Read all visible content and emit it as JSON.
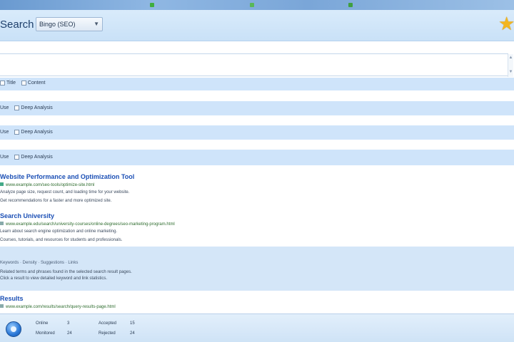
{
  "window": {
    "caption": ""
  },
  "header": {
    "title": "Search",
    "engine": "Bingo (SEO)",
    "star_label": "★"
  },
  "search": {
    "value": ""
  },
  "options": {
    "row1": [
      "Title",
      "Content"
    ],
    "row2": [
      "Use",
      "Deep Analysis"
    ],
    "row3": [
      "Use",
      "Deep Analysis"
    ],
    "row4": [
      "Use",
      "Deep Analysis"
    ]
  },
  "results": [
    {
      "title": "Website Performance and Optimization Tool",
      "url": "www.example.com/seo-tools/optimize-site.html",
      "snippet": [
        "Analyze page size, request count, and loading time for your website.",
        "Get recommendations for a faster and more optimized site."
      ]
    },
    {
      "title": "Search University",
      "url": "www.example.edu/search/university-courses/online-degrees/seo-marketing-program.html",
      "snippet": [
        "Learn about search engine optimization and online marketing.",
        "Courses, tutorials, and resources for students and professionals."
      ]
    }
  ],
  "highlight": {
    "line1": "Keywords · Density · Suggestions · Links",
    "line2": "Related terms and phrases found in the selected search result pages.",
    "line3": "Click a result to view detailed keyword and link statistics."
  },
  "result3": {
    "title": "Results",
    "url": "www.example.com/results/search/query-results-page.html"
  },
  "footer": {
    "stats": [
      {
        "label": "Online",
        "value": "3"
      },
      {
        "label": "Accepted",
        "value": "15"
      },
      {
        "label": "Monitored",
        "value": "24"
      },
      {
        "label": "Rejected",
        "value": "24"
      }
    ]
  },
  "colors": {
    "accent": "#1b4fb5",
    "band": "#cfe4fa",
    "header": "#d9ebfb",
    "star": "#f2b51f"
  }
}
